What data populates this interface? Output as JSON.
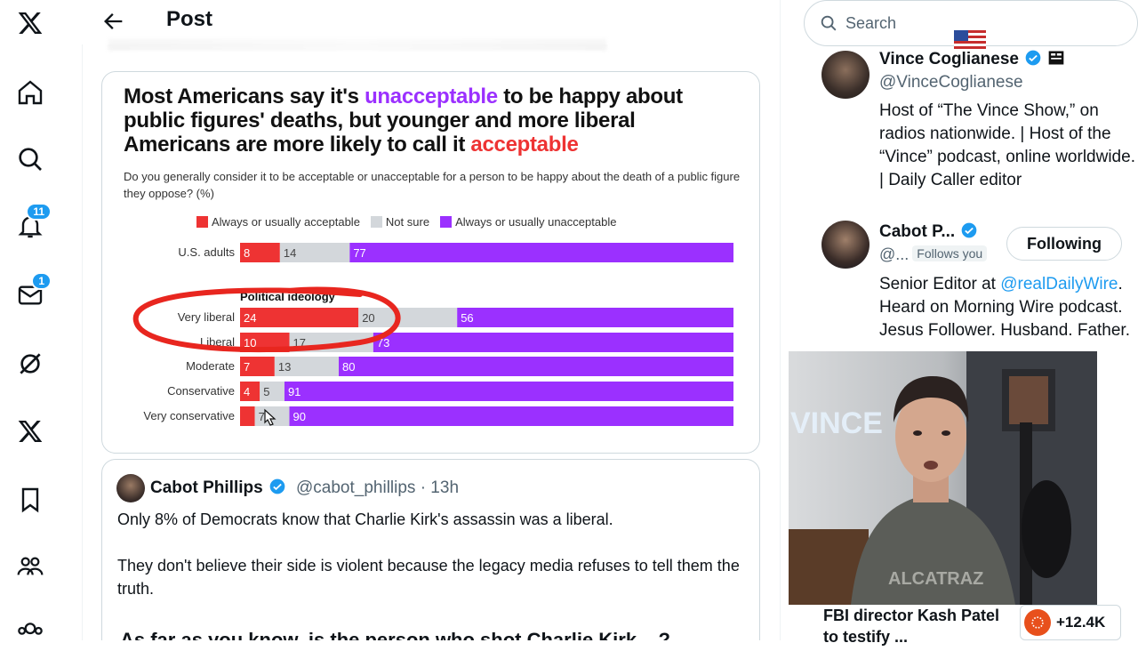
{
  "header": {
    "title": "Post"
  },
  "nav": {
    "notifications_badge": "11",
    "messages_badge": "1"
  },
  "chart_card": {
    "headline_part1": "Most Americans say it's ",
    "headline_purple": "unacceptable",
    "headline_part2": " to be happy about public figures' deaths, but younger and more liberal Americans are more likely to call it ",
    "headline_red": "acceptable",
    "question": "Do you generally consider it to be acceptable or unacceptable for a person to be happy about the death of a public figure they oppose? (%)",
    "legend": [
      {
        "label": "Always or usually acceptable",
        "color": "#ee3333"
      },
      {
        "label": "Not sure",
        "color": "#d3d7db"
      },
      {
        "label": "Always or usually unacceptable",
        "color": "#9b30ff"
      }
    ],
    "group_label": "Political ideology"
  },
  "chart_data": {
    "type": "bar",
    "stacked": true,
    "orientation": "horizontal",
    "title": "Most Americans say it's unacceptable to be happy about public figures' deaths, but younger and more liberal Americans are more likely to call it acceptable",
    "subtitle": "Do you generally consider it to be acceptable or unacceptable for a person to be happy about the death of a public figure they oppose? (%)",
    "categories": [
      "U.S. adults",
      "Very liberal",
      "Liberal",
      "Moderate",
      "Conservative",
      "Very conservative"
    ],
    "series": [
      {
        "name": "Always or usually acceptable",
        "color": "#ee3333",
        "values": [
          8,
          24,
          10,
          7,
          4,
          3
        ],
        "labels": [
          "8",
          "24",
          "10",
          "7",
          "4",
          ""
        ]
      },
      {
        "name": "Not sure",
        "color": "#d3d7db",
        "values": [
          14,
          20,
          17,
          13,
          5,
          7
        ],
        "labels": [
          "14",
          "20",
          "17",
          "13",
          "5",
          "7"
        ]
      },
      {
        "name": "Always or usually unacceptable",
        "color": "#9b30ff",
        "values": [
          77,
          56,
          73,
          80,
          91,
          90
        ],
        "labels": [
          "77",
          "56",
          "73",
          "80",
          "91",
          "90"
        ]
      }
    ],
    "legend_position": "top",
    "annotation": "red hand-drawn circle around Very liberal and Liberal rows"
  },
  "tweet": {
    "name": "Cabot Phillips",
    "handle_time": "@cabot_phillips · 13h",
    "text1": "Only 8% of Democrats know that Charlie Kirk's assassin was a liberal.",
    "text2": "They don't believe their side is violent because the legacy media refuses to tell them the truth.",
    "quote_start": "As far as you know, is the person who shot Charlie Kirk... ?"
  },
  "search": {
    "placeholder": "Search"
  },
  "suggestions": [
    {
      "name": "Vince Coglianese",
      "handle": "@VinceCoglianese",
      "bio": "Host of “The Vince Show,” on radios nationwide. | Host of the “Vince” podcast, online worldwide. | Daily Caller editor"
    },
    {
      "name": "Cabot P...",
      "handle": "@...",
      "follows_you": "Follows you",
      "button": "Following",
      "bio_pre": "Senior Editor at ",
      "bio_link": "@realDailyWire",
      "bio_post": ". Heard on Morning Wire podcast. Jesus Follower. Husband. Father."
    }
  ],
  "trend": {
    "text": "FBI director Kash Patel to testify ...",
    "count": "+12.4K"
  },
  "webcam": {
    "wall_text": "VINCE",
    "shirt_text": "ALCATRAZ"
  },
  "colors": {
    "accent": "#1d9bf0",
    "purple": "#9b30ff",
    "red": "#ee3333",
    "grey": "#d3d7db"
  }
}
